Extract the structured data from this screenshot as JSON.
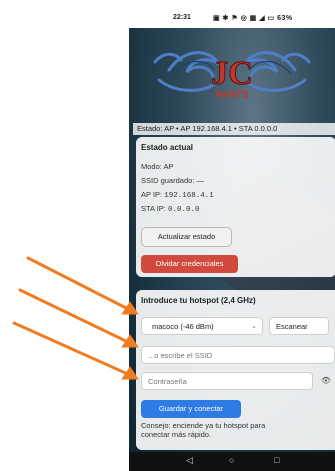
{
  "status_bar": {
    "time": "22:31",
    "icons": "▣ ✱ ⚑ ◎ ▦ ◢ ▭ 63%"
  },
  "brand": {
    "logo_text": "JC",
    "logo_sub": "PARTS",
    "accent": "#c0392b",
    "ornament_color": "#4f7fc8"
  },
  "status_line": "Estado: AP • AP 192.168.4.1 • STA 0.0.0.0",
  "estado": {
    "title": "Estado actual",
    "modo_label": "Modo: AP",
    "ssid_label": "SSID guardado: —",
    "ap_ip_label": "AP IP:",
    "ap_ip_value": "192.168.4.1",
    "sta_ip_label": "STA IP:",
    "sta_ip_value": "0.0.0.0",
    "refresh_button": "Actualizar estado",
    "forget_button": "Olvidar credenciales"
  },
  "hotspot": {
    "title": "Introduce tu hotspot (2,4 GHz)",
    "network_selected": "macoco (-46 dBm)",
    "scan_button": "Escanear",
    "ssid_placeholder": "...o escribe el SSID",
    "password_placeholder": "Contraseña",
    "save_button": "Guardar y conectar",
    "tip": "Consejo: enciende ya tu hotspot para conectar más rápido."
  },
  "colors": {
    "primary": "#2f7be6",
    "danger": "#d04b3e",
    "annotation_arrow": "#f07c22"
  },
  "nav": {
    "back": "◁",
    "home": "○",
    "recent": "□"
  }
}
